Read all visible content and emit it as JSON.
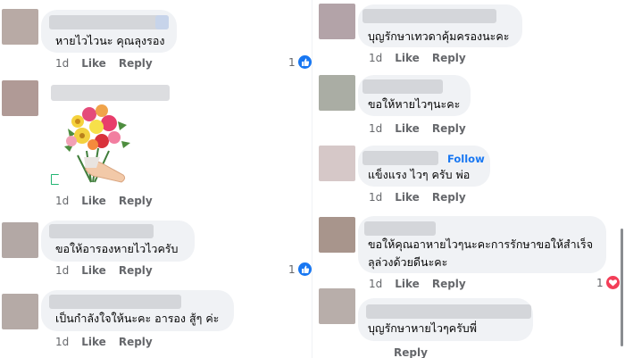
{
  "colors": {
    "bubble_bg": "#f0f2f5",
    "meta_text": "#65676b",
    "like_blue": "#1877f2",
    "love_red": "#f33e58"
  },
  "left": {
    "comments": [
      {
        "text": "หายไวไวนะ คุณลุงรอง",
        "time": "1d",
        "like": "Like",
        "reply": "Reply",
        "reactions": "1",
        "reaction_icon": "like-icon"
      },
      {
        "text": "",
        "sticker": "flower-bouquet",
        "time": "1d",
        "like": "Like",
        "reply": "Reply"
      },
      {
        "text": "ขอให้อารองหายไวไวครับ",
        "time": "1d",
        "like": "Like",
        "reply": "Reply",
        "reactions": "1",
        "reaction_icon": "like-icon"
      },
      {
        "text": "เป็นกำลังใจให้นะคะ อารอง สู้ๆ ค่ะ",
        "time": "1d",
        "like": "Like",
        "reply": "Reply"
      }
    ]
  },
  "right": {
    "comments": [
      {
        "text": "บุญรักษาเทวดาคุ้มครองนะคะ",
        "time": "1d",
        "like": "Like",
        "reply": "Reply"
      },
      {
        "text": "ขอให้หายไวๆนะคะ",
        "time": "1d",
        "like": "Like",
        "reply": "Reply"
      },
      {
        "text": "แข็งแรง ไวๆ ครับ พ่อ",
        "follow": "Follow",
        "time": "1d",
        "like": "Like",
        "reply": "Reply"
      },
      {
        "text_line1": "ขอให้คุณอาหายไวๆนะคะการรักษาขอให้สำเร็จ",
        "text_line2": "ลุล่วงด้วยดีนะคะ",
        "time": "1d",
        "like": "Like",
        "reply": "Reply",
        "reactions": "1",
        "reaction_icon": "love-icon"
      },
      {
        "text": "บุญรักษาหายไวๆครับพี่",
        "time": "",
        "like": "",
        "reply": "Reply"
      }
    ]
  }
}
